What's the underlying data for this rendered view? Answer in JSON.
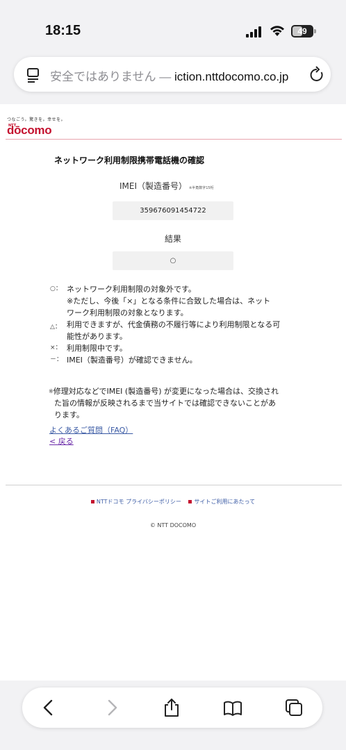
{
  "status_bar": {
    "time": "18:15",
    "battery": "49",
    "battery_level": 0.49,
    "icons": [
      "signal-icon",
      "wifi-icon",
      "battery-icon"
    ]
  },
  "browser": {
    "address_warning": "安全ではありません —",
    "address_url": "iction.nttdocomo.co.jp",
    "icons": [
      "page-menu-icon",
      "reload-icon"
    ]
  },
  "brand": {
    "tagline": "つなごう。驚きを。幸せを。",
    "ntt": "NTT",
    "logo": "dōcomo",
    "color": "#c4122f"
  },
  "page": {
    "title": "ネットワーク利用制限携帯電話機の確認",
    "imei_label": "IMEI（製造番号）",
    "imei_note": "※半角数字15桁",
    "imei_value": "359676091454722",
    "result_label": "結果",
    "result_value": "○"
  },
  "legend": [
    {
      "symbol": "○：",
      "lines": [
        "ネットワーク利用制限の対象外です。",
        "※ただし、今後「×」となる条件に合致した場合は、ネット",
        "ワーク利用制限の対象となります。"
      ]
    },
    {
      "symbol": "△：",
      "lines": [
        "利用できますが、代金債務の不履行等により利用制限となる可",
        "能性があります。"
      ]
    },
    {
      "symbol": "×：",
      "lines": [
        "利用制限中です。"
      ]
    },
    {
      "symbol": "－：",
      "lines": [
        "IMEI（製造番号）が確認できません。"
      ]
    }
  ],
  "notice": {
    "mark": "※",
    "line1": "修理対応などでIMEI (製造番号) が変更になった場合は、交換され",
    "line2": "た旨の情報が反映されるまで当サイトでは確認できないことがあ",
    "line3": "ります。"
  },
  "links": {
    "faq": "よくあるご質問（FAQ）",
    "back": "< 戻る"
  },
  "footer": {
    "privacy": "NTTドコモ プライバシーポリシー",
    "terms": "サイトご利用にあたって",
    "copyright": "© NTT DOCOMO"
  },
  "toolbar": {
    "icons": [
      "back-icon",
      "forward-icon",
      "share-icon",
      "bookmarks-icon",
      "tabs-icon"
    ]
  }
}
